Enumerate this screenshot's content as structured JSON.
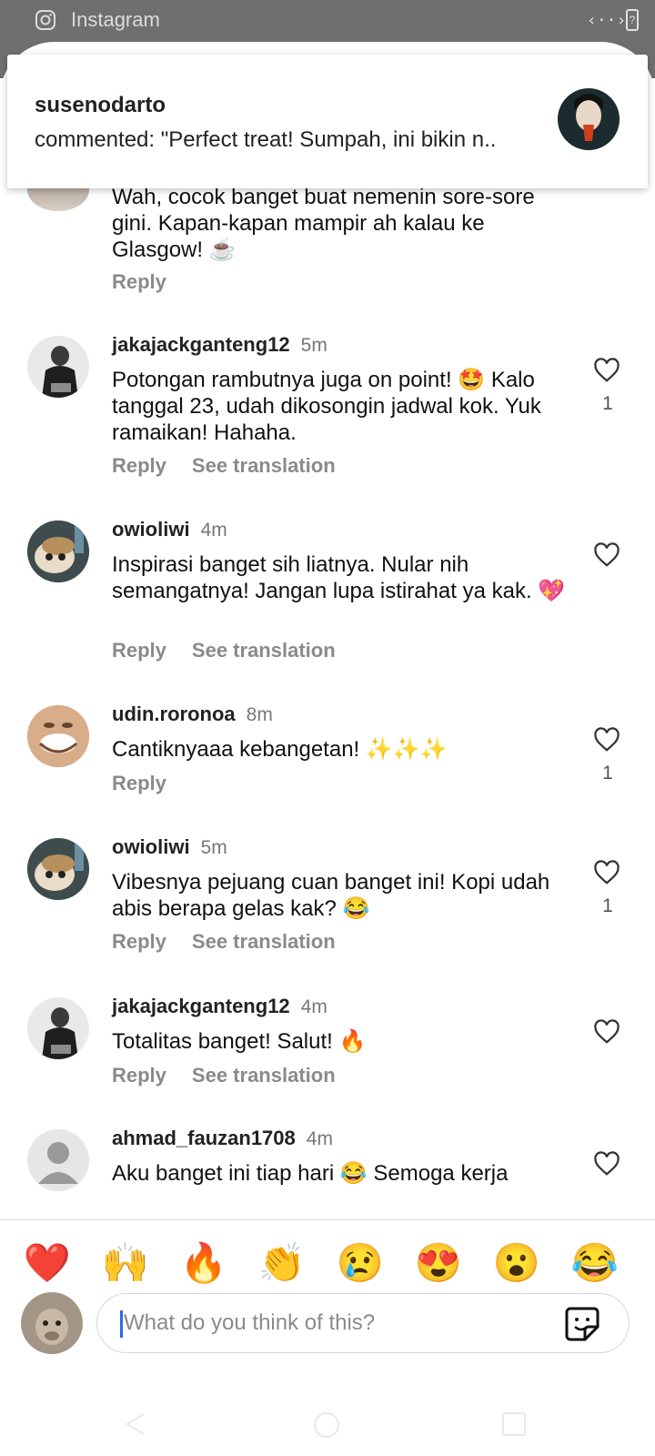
{
  "status_bar": {
    "app_title": "Instagram",
    "code_icon": "‹··›",
    "battery_icon": "?"
  },
  "notification": {
    "username": "susenodarto",
    "message": "commented: \"Perfect treat! Sumpah, ini bikin n.."
  },
  "partial_comment": {
    "text": "Wah, cocok banget buat nemenin sore-sore gini. Kapan-kapan mampir ah kalau ke Glasgow! ☕",
    "reply": "Reply"
  },
  "comments": [
    {
      "username": "jakajackganteng12",
      "time": "5m",
      "text": "Potongan rambutnya juga on point! 🤩 Kalo tanggal 23, udah dikosongin jadwal kok. Yuk ramaikan! Hahaha.",
      "reply": "Reply",
      "translation": "See translation",
      "likes": "1"
    },
    {
      "username": "owioliwi",
      "time": "4m",
      "text": "Inspirasi banget sih liatnya. Nular nih semangatnya! Jangan lupa istirahat ya kak. 💖",
      "reply": "Reply",
      "translation": "See translation",
      "likes": ""
    },
    {
      "username": "udin.roronoa",
      "time": "8m",
      "text": "Cantiknyaaa kebangetan! ✨✨✨",
      "reply": "Reply",
      "translation": "",
      "likes": "1"
    },
    {
      "username": "owioliwi",
      "time": "5m",
      "text": "Vibesnya pejuang cuan banget ini! Kopi udah abis berapa gelas kak? 😂",
      "reply": "Reply",
      "translation": "See translation",
      "likes": "1"
    },
    {
      "username": "jakajackganteng12",
      "time": "4m",
      "text": "Totalitas banget! Salut! 🔥",
      "reply": "Reply",
      "translation": "See translation",
      "likes": ""
    },
    {
      "username": "ahmad_fauzan1708",
      "time": "4m",
      "text": "Aku banget ini tiap hari 😂 Semoga kerja",
      "reply": "",
      "translation": "",
      "likes": ""
    }
  ],
  "emoji_bar": [
    "❤️",
    "🙌",
    "🔥",
    "👏",
    "😢",
    "😍",
    "😮",
    "😂"
  ],
  "composer": {
    "placeholder": "What do you think of this?"
  },
  "icons": {
    "instagram": "instagram-icon",
    "heart": "heart-icon",
    "sticker": "sticker-icon",
    "back": "nav-back-icon",
    "home": "nav-home-icon",
    "recent": "nav-recent-icon"
  }
}
